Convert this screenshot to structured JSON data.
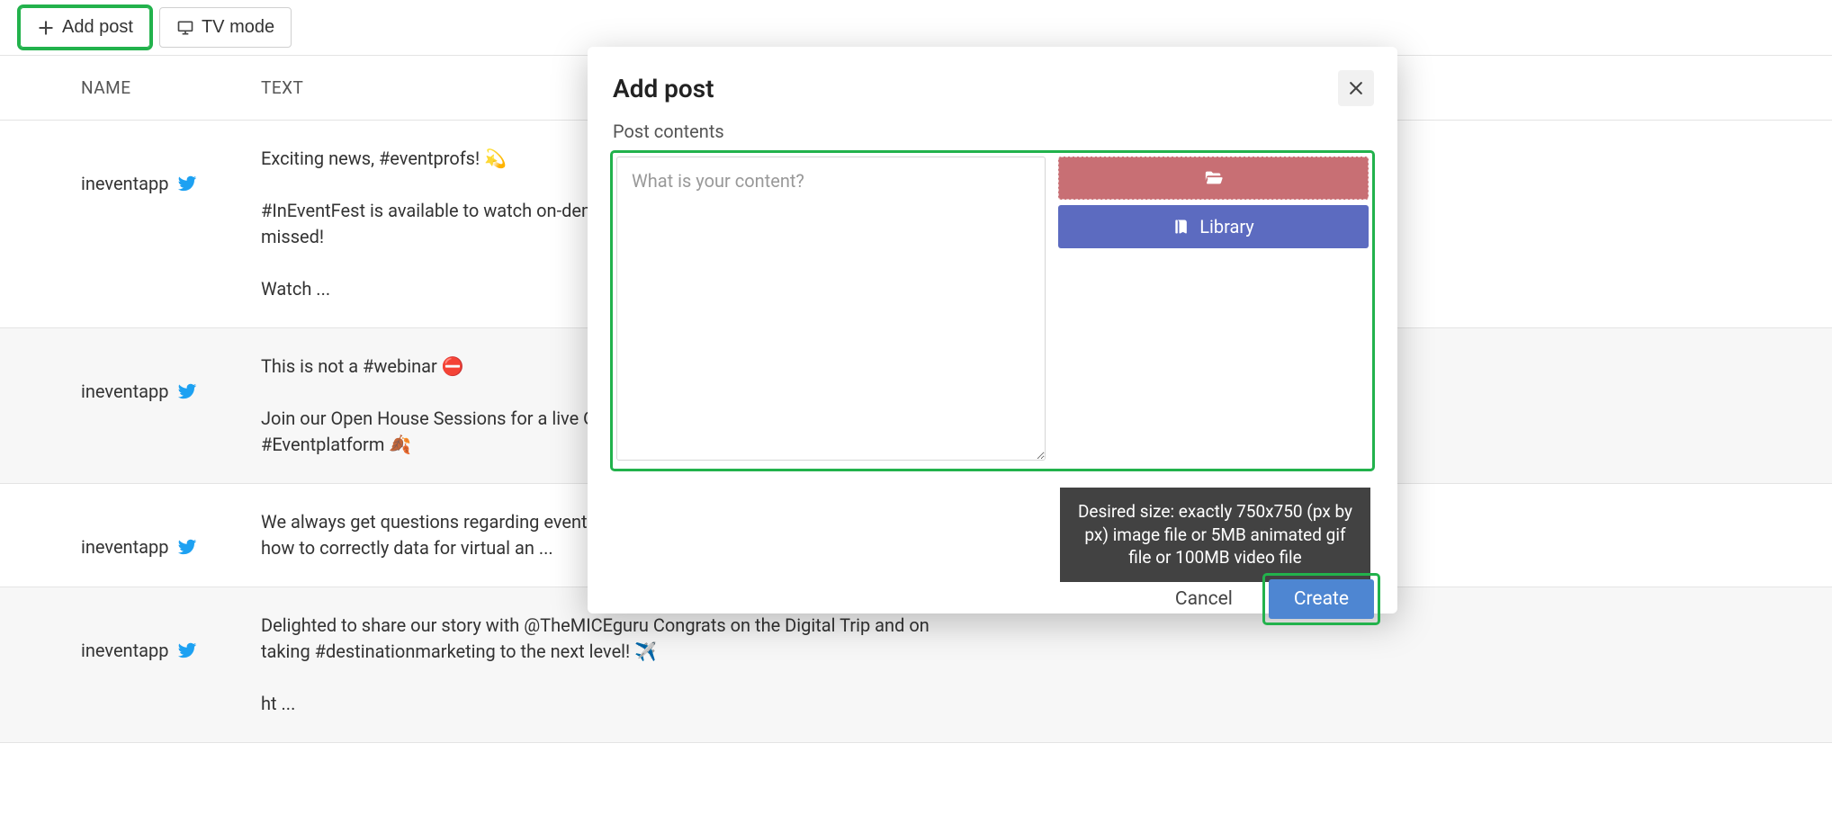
{
  "toolbar": {
    "add_post": "Add post",
    "tv_mode": "TV mode"
  },
  "table": {
    "headers": {
      "name": "NAME",
      "text": "TEXT"
    },
    "rows": [
      {
        "name": "ineventapp",
        "text": "Exciting news, #eventprofs! 💫\n\n#InEventFest is available to watch on-demand. Yo register and check what you've missed!\n\nWatch ..."
      },
      {
        "name": "ineventapp",
        "text": "This is not a #webinar ⛔\n\nJoin our Open House Sessions for a live Q&A and how to make the best out of our #Eventplatform 🍂"
      },
      {
        "name": "ineventapp",
        "text": "We always get questions regarding event analytic out our latest blog post and learn how to correctly data for virtual an ..."
      },
      {
        "name": "ineventapp",
        "text": "Delighted to share our story with @TheMICEguru Congrats on the Digital Trip and on taking #destinationmarketing to the next level! ✈️\n\nht ..."
      }
    ]
  },
  "modal": {
    "title": "Add post",
    "section_label": "Post contents",
    "textarea_placeholder": "What is your content?",
    "library_label": "Library",
    "hint": "Desired size: exactly 750x750 (px by px) image file or 5MB animated gif file or 100MB video file",
    "cancel": "Cancel",
    "create": "Create"
  }
}
